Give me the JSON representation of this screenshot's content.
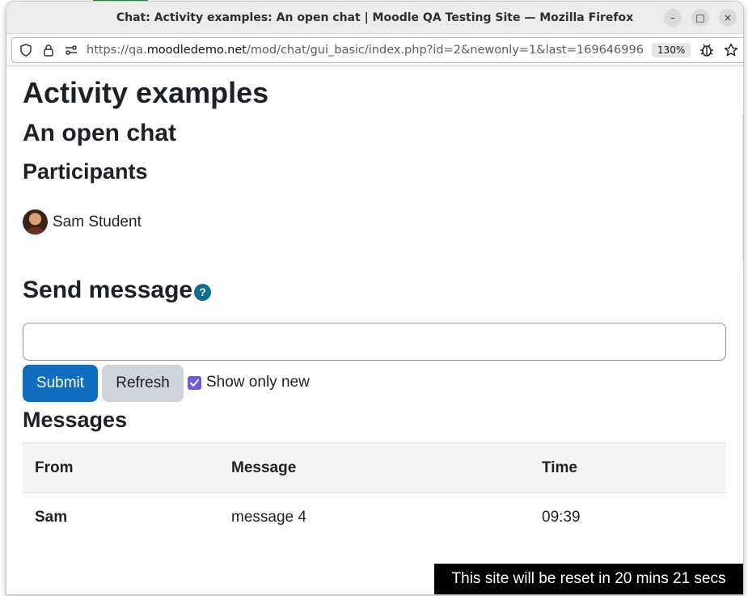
{
  "browser": {
    "window_title": "Chat: Activity examples: An open chat | Moodle QA Testing Site — Mozilla Firefox",
    "url_prefix": "https://qa.",
    "url_host": "moodledemo.net",
    "url_path": "/mod/chat/gui_basic/index.php?id=2&newonly=1&last=169646996",
    "zoom": "130%",
    "controls": {
      "minimize": "–",
      "maximize": "□",
      "close": "×"
    }
  },
  "page": {
    "course_title": "Activity examples",
    "chat_title": "An open chat",
    "participants_heading": "Participants",
    "participants": [
      {
        "name": "Sam Student"
      }
    ],
    "send_heading": "Send message",
    "help_icon": "?",
    "message_input": {
      "value": "",
      "placeholder": ""
    },
    "submit_label": "Submit",
    "refresh_label": "Refresh",
    "show_only_new_label": "Show only new",
    "show_only_new_checked": true,
    "messages_heading": "Messages",
    "table": {
      "headers": {
        "from": "From",
        "message": "Message",
        "time": "Time"
      },
      "rows": [
        {
          "from": "Sam",
          "message": "message 4",
          "time": "09:39"
        }
      ]
    },
    "reset_banner": "This site will be reset in 20 mins 21 secs"
  },
  "colors": {
    "primary": "#0f6cbf",
    "secondary": "#ced4da",
    "help": "#0f6c8a",
    "checkbox": "#6f5bd6",
    "text": "#1d2125"
  }
}
